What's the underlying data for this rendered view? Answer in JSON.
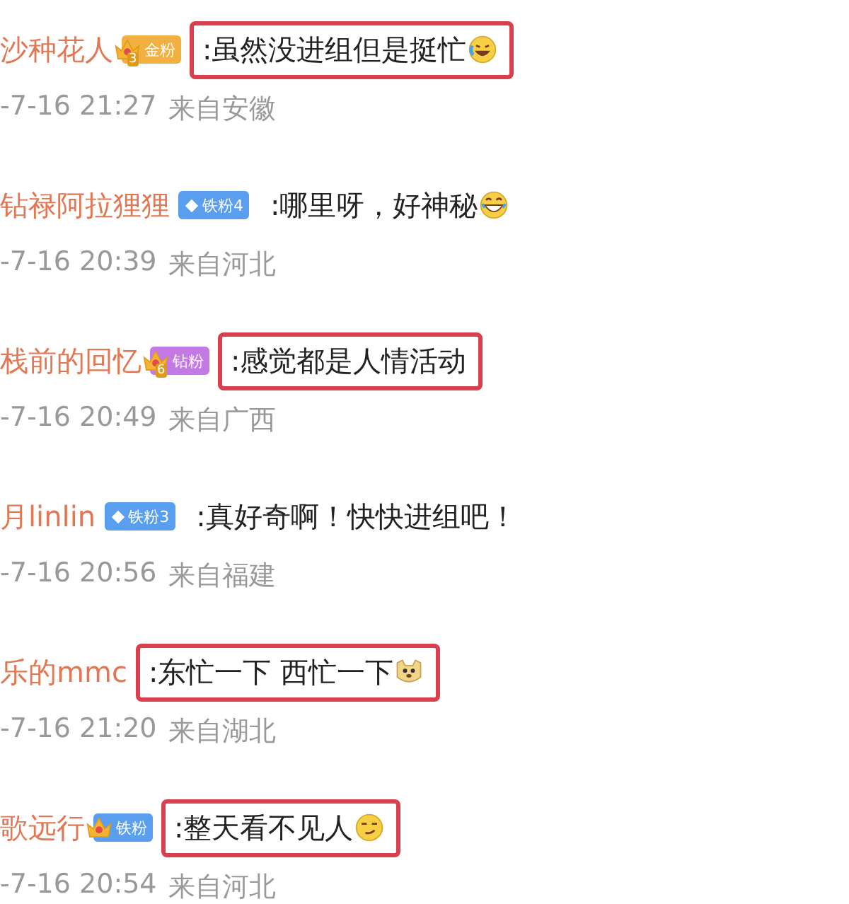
{
  "comments": [
    {
      "name": "沙种花人",
      "badge": {
        "kind": "crown",
        "crown_level": "3",
        "label": "金粉",
        "color": "#f2b040"
      },
      "text": ":虽然没进组但是挺忙",
      "emoji": {
        "kind": "laugh-cry"
      },
      "highlighted": true,
      "time": "-7-16 21:27",
      "location": "来自安徽"
    },
    {
      "name": "钻禄阿拉狸狸",
      "badge": {
        "kind": "diamond",
        "label": "铁粉4",
        "color": "#5a9ef0"
      },
      "text": ":哪里呀，好神秘",
      "emoji": {
        "kind": "laughing"
      },
      "highlighted": false,
      "time": "-7-16 20:39",
      "location": "来自河北"
    },
    {
      "name": "栈前的回忆",
      "badge": {
        "kind": "crown",
        "crown_level": "6",
        "label": "钻粉",
        "color": "#c47ae6"
      },
      "text": ":感觉都是人情活动",
      "highlighted": true,
      "time": "-7-16 20:49",
      "location": "来自广西"
    },
    {
      "name": "月linlin",
      "badge": {
        "kind": "diamond",
        "label": "铁粉3",
        "color": "#5a9ef0"
      },
      "text": ":真好奇啊！快快进组吧！",
      "highlighted": false,
      "time": "-7-16 20:56",
      "location": "来自福建"
    },
    {
      "name": "乐的mmc",
      "text": ":东忙一下 西忙一下",
      "emoji": {
        "kind": "dog"
      },
      "highlighted": true,
      "time": "-7-16 21:20",
      "location": "来自湖北"
    },
    {
      "name": "歌远行",
      "badge": {
        "kind": "crown",
        "label": "铁粉",
        "color": "#5a9ef0"
      },
      "text": ":整天看不见人",
      "emoji": {
        "kind": "smirk"
      },
      "highlighted": true,
      "time": "-7-16 20:54",
      "location": "来自河北"
    }
  ]
}
